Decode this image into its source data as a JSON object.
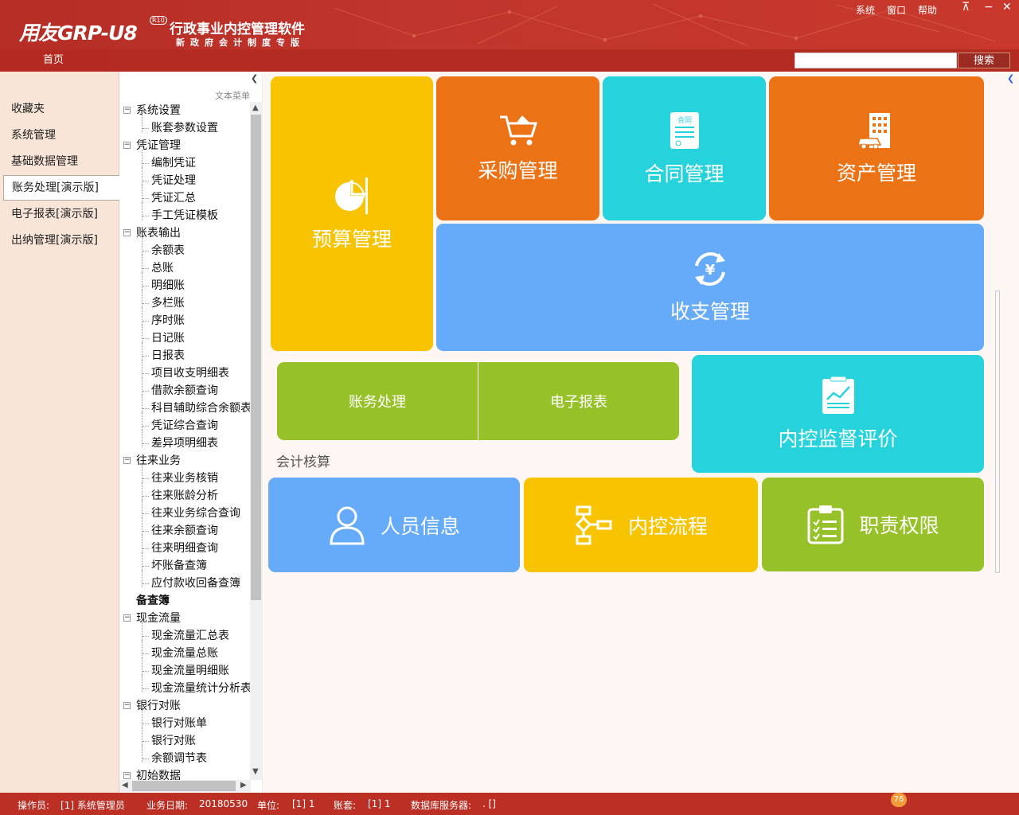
{
  "header": {
    "brand": "用友GRP-U8",
    "brand_badge": "R10",
    "product_title": "行政事业内控管理软件",
    "product_subtitle": "新政府会计制度专版",
    "menu": [
      "系统",
      "窗口",
      "帮助"
    ],
    "home_tab": "首页",
    "search_placeholder": "",
    "search_button": "搜索"
  },
  "leftnav": {
    "items": [
      "收藏夹",
      "系统管理",
      "基础数据管理",
      "账务处理[演示版]",
      "电子报表[演示版]",
      "出纳管理[演示版]"
    ],
    "active_index": 3
  },
  "tree": {
    "mode_label": "文本菜单",
    "nodes": [
      {
        "label": "系统设置",
        "level": 0,
        "expanded": true
      },
      {
        "label": "账套参数设置",
        "level": 1
      },
      {
        "label": "凭证管理",
        "level": 0,
        "expanded": true
      },
      {
        "label": "编制凭证",
        "level": 1
      },
      {
        "label": "凭证处理",
        "level": 1
      },
      {
        "label": "凭证汇总",
        "level": 1
      },
      {
        "label": "手工凭证模板",
        "level": 1
      },
      {
        "label": "账表输出",
        "level": 0,
        "expanded": true
      },
      {
        "label": "余额表",
        "level": 1
      },
      {
        "label": "总账",
        "level": 1
      },
      {
        "label": "明细账",
        "level": 1
      },
      {
        "label": "多栏账",
        "level": 1
      },
      {
        "label": "序时账",
        "level": 1
      },
      {
        "label": "日记账",
        "level": 1
      },
      {
        "label": "日报表",
        "level": 1
      },
      {
        "label": "项目收支明细表",
        "level": 1
      },
      {
        "label": "借款余额查询",
        "level": 1
      },
      {
        "label": "科目辅助综合余额表",
        "level": 1
      },
      {
        "label": "凭证综合查询",
        "level": 1
      },
      {
        "label": "差异项明细表",
        "level": 1
      },
      {
        "label": "往来业务",
        "level": 0,
        "expanded": true
      },
      {
        "label": "往来业务核销",
        "level": 1
      },
      {
        "label": "往来账龄分析",
        "level": 1
      },
      {
        "label": "往来业务综合查询",
        "level": 1
      },
      {
        "label": "往来余额查询",
        "level": 1
      },
      {
        "label": "往来明细查询",
        "level": 1
      },
      {
        "label": "坏账备查簿",
        "level": 1
      },
      {
        "label": "应付款收回备查簿",
        "level": 1
      },
      {
        "label": "备查簿",
        "level": 0,
        "leaf": true
      },
      {
        "label": "现金流量",
        "level": 0,
        "expanded": true
      },
      {
        "label": "现金流量汇总表",
        "level": 1
      },
      {
        "label": "现金流量总账",
        "level": 1
      },
      {
        "label": "现金流量明细账",
        "level": 1
      },
      {
        "label": "现金流量统计分析表",
        "level": 1
      },
      {
        "label": "银行对账",
        "level": 0,
        "expanded": true
      },
      {
        "label": "银行对账单",
        "level": 1
      },
      {
        "label": "银行对账",
        "level": 1
      },
      {
        "label": "余额调节表",
        "level": 1
      },
      {
        "label": "初始数据",
        "level": 0,
        "expanded": true
      }
    ]
  },
  "tiles": {
    "budget": {
      "label": "预算管理",
      "icon": "pie-chart-icon",
      "color": "#f8c300"
    },
    "purchase": {
      "label": "采购管理",
      "icon": "shopping-cart-icon",
      "color": "#ec7216"
    },
    "contract": {
      "label": "合同管理",
      "icon": "contract-doc-icon",
      "icon_text": "合同",
      "color": "#26d3dc"
    },
    "asset": {
      "label": "资产管理",
      "icon": "building-car-icon",
      "color": "#ec7216"
    },
    "income_expense": {
      "label": "收支管理",
      "icon": "yen-cycle-icon",
      "color": "#66abf9"
    },
    "accounting": {
      "label": "账务处理",
      "color": "#96c128"
    },
    "report": {
      "label": "电子报表",
      "color": "#96c128"
    },
    "supervision": {
      "label": "内控监督评价",
      "icon": "report-chart-icon",
      "color": "#26d3dc"
    },
    "personnel": {
      "label": "人员信息",
      "icon": "user-icon",
      "color": "#66abf9"
    },
    "process": {
      "label": "内控流程",
      "icon": "flowchart-icon",
      "color": "#f8c300"
    },
    "authority": {
      "label": "职责权限",
      "icon": "clipboard-lock-icon",
      "color": "#96c128"
    }
  },
  "section_label": "会计核算",
  "status": {
    "operator_label": "操作员:",
    "operator": "[1] 系统管理员",
    "date_label": "业务日期:",
    "date": "20180530",
    "unit_label": "单位:",
    "unit": "[1] 1",
    "book_label": "账套:",
    "book": "[1] 1",
    "db_label": "数据库服务器:",
    "db": ". []",
    "notification_count": "76"
  }
}
